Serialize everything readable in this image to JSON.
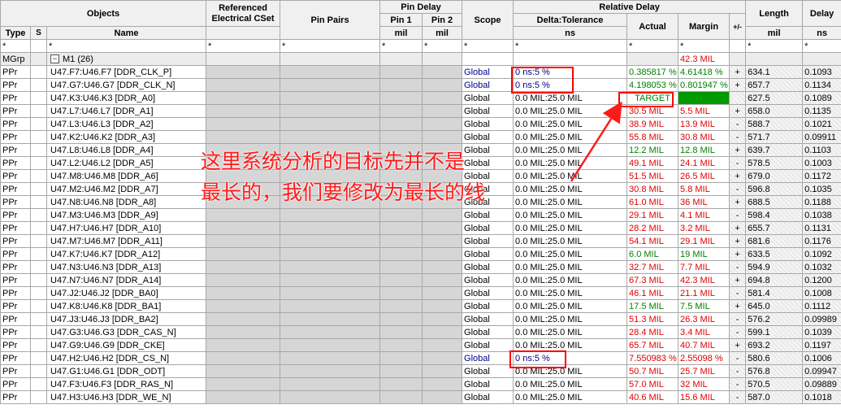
{
  "header": {
    "objects": "Objects",
    "ref_cset": "Referenced Electrical CSet",
    "pin_pairs": "Pin Pairs",
    "pin_delay": "Pin Delay",
    "pin1": "Pin 1",
    "pin2": "Pin 2",
    "scope": "Scope",
    "relative_delay": "Relative Delay",
    "delta_tol": "Delta:Tolerance",
    "actual": "Actual",
    "margin": "Margin",
    "plusminus": "+/-",
    "length": "Length",
    "delay": "Delay",
    "type": "Type",
    "s": "S",
    "name": "Name",
    "unit_mil": "mil",
    "unit_ns": "ns",
    "star": "*"
  },
  "group": {
    "type": "MGrp",
    "name": "M1 (26)",
    "margin": "42.3 MIL"
  },
  "rows": [
    {
      "type": "PPr",
      "name": "U47.F7:U46.F7 [DDR_CLK_P]",
      "scope": "Global",
      "tol": "0 ns:5 %",
      "actual": "0.385817 %",
      "margin": "4.61418 %",
      "pm": "+",
      "length": "634.1",
      "delay": "0.1093",
      "status": "green",
      "override": true
    },
    {
      "type": "PPr",
      "name": "U47.G7:U46.G7 [DDR_CLK_N]",
      "scope": "Global",
      "tol": "0 ns:5 %",
      "actual": "4.198053 %",
      "margin": "0.801947 %",
      "pm": "+",
      "length": "657.7",
      "delay": "0.1134",
      "status": "green",
      "override": true
    },
    {
      "type": "PPr",
      "name": "U47.K3:U46.K3 [DDR_A0]",
      "scope": "Global",
      "tol": "0.0 MIL:25.0 MIL",
      "actual": "TARGET",
      "margin": "",
      "pm": "",
      "length": "627.5",
      "delay": "0.1089",
      "status": "target",
      "override": false
    },
    {
      "type": "PPr",
      "name": "U47.L7:U46.L7 [DDR_A1]",
      "scope": "Global",
      "tol": "0.0 MIL:25.0 MIL",
      "actual": "30.5 MIL",
      "margin": "5.5 MIL",
      "pm": "+",
      "length": "658.0",
      "delay": "0.1135",
      "status": "red",
      "override": false
    },
    {
      "type": "PPr",
      "name": "U47.L3:U46.L3 [DDR_A2]",
      "scope": "Global",
      "tol": "0.0 MIL:25.0 MIL",
      "actual": "38.9 MIL",
      "margin": "13.9 MIL",
      "pm": "-",
      "length": "588.7",
      "delay": "0.1021",
      "status": "red",
      "override": false
    },
    {
      "type": "PPr",
      "name": "U47.K2:U46.K2 [DDR_A3]",
      "scope": "Global",
      "tol": "0.0 MIL:25.0 MIL",
      "actual": "55.8 MIL",
      "margin": "30.8 MIL",
      "pm": "-",
      "length": "571.7",
      "delay": "0.09911",
      "status": "red",
      "override": false
    },
    {
      "type": "PPr",
      "name": "U47.L8:U46.L8 [DDR_A4]",
      "scope": "Global",
      "tol": "0.0 MIL:25.0 MIL",
      "actual": "12.2 MIL",
      "margin": "12.8 MIL",
      "pm": "+",
      "length": "639.7",
      "delay": "0.1103",
      "status": "green",
      "override": false
    },
    {
      "type": "PPr",
      "name": "U47.L2:U46.L2 [DDR_A5]",
      "scope": "Global",
      "tol": "0.0 MIL:25.0 MIL",
      "actual": "49.1 MIL",
      "margin": "24.1 MIL",
      "pm": "-",
      "length": "578.5",
      "delay": "0.1003",
      "status": "red",
      "override": false
    },
    {
      "type": "PPr",
      "name": "U47.M8:U46.M8 [DDR_A6]",
      "scope": "Global",
      "tol": "0.0 MIL:25.0 MIL",
      "actual": "51.5 MIL",
      "margin": "26.5 MIL",
      "pm": "+",
      "length": "679.0",
      "delay": "0.1172",
      "status": "red",
      "override": false
    },
    {
      "type": "PPr",
      "name": "U47.M2:U46.M2 [DDR_A7]",
      "scope": "Global",
      "tol": "0.0 MIL:25.0 MIL",
      "actual": "30.8 MIL",
      "margin": "5.8 MIL",
      "pm": "-",
      "length": "596.8",
      "delay": "0.1035",
      "status": "red",
      "override": false
    },
    {
      "type": "PPr",
      "name": "U47.N8:U46.N8 [DDR_A8]",
      "scope": "Global",
      "tol": "0.0 MIL:25.0 MIL",
      "actual": "61.0 MIL",
      "margin": "36 MIL",
      "pm": "+",
      "length": "688.5",
      "delay": "0.1188",
      "status": "red",
      "override": false
    },
    {
      "type": "PPr",
      "name": "U47.M3:U46.M3 [DDR_A9]",
      "scope": "Global",
      "tol": "0.0 MIL:25.0 MIL",
      "actual": "29.1 MIL",
      "margin": "4.1 MIL",
      "pm": "-",
      "length": "598.4",
      "delay": "0.1038",
      "status": "red",
      "override": false
    },
    {
      "type": "PPr",
      "name": "U47.H7:U46.H7 [DDR_A10]",
      "scope": "Global",
      "tol": "0.0 MIL:25.0 MIL",
      "actual": "28.2 MIL",
      "margin": "3.2 MIL",
      "pm": "+",
      "length": "655.7",
      "delay": "0.1131",
      "status": "red",
      "override": false
    },
    {
      "type": "PPr",
      "name": "U47.M7:U46.M7 [DDR_A11]",
      "scope": "Global",
      "tol": "0.0 MIL:25.0 MIL",
      "actual": "54.1 MIL",
      "margin": "29.1 MIL",
      "pm": "+",
      "length": "681.6",
      "delay": "0.1176",
      "status": "red",
      "override": false
    },
    {
      "type": "PPr",
      "name": "U47.K7:U46.K7 [DDR_A12]",
      "scope": "Global",
      "tol": "0.0 MIL:25.0 MIL",
      "actual": "6.0 MIL",
      "margin": "19 MIL",
      "pm": "+",
      "length": "633.5",
      "delay": "0.1092",
      "status": "green",
      "override": false
    },
    {
      "type": "PPr",
      "name": "U47.N3:U46.N3 [DDR_A13]",
      "scope": "Global",
      "tol": "0.0 MIL:25.0 MIL",
      "actual": "32.7 MIL",
      "margin": "7.7 MIL",
      "pm": "-",
      "length": "594.9",
      "delay": "0.1032",
      "status": "red",
      "override": false
    },
    {
      "type": "PPr",
      "name": "U47.N7:U46.N7 [DDR_A14]",
      "scope": "Global",
      "tol": "0.0 MIL:25.0 MIL",
      "actual": "67.3 MIL",
      "margin": "42.3 MIL",
      "pm": "+",
      "length": "694.8",
      "delay": "0.1200",
      "status": "red",
      "override": false
    },
    {
      "type": "PPr",
      "name": "U47.J2:U46.J2 [DDR_BA0]",
      "scope": "Global",
      "tol": "0.0 MIL:25.0 MIL",
      "actual": "46.1 MIL",
      "margin": "21.1 MIL",
      "pm": "-",
      "length": "581.4",
      "delay": "0.1008",
      "status": "red",
      "override": false
    },
    {
      "type": "PPr",
      "name": "U47.K8:U46.K8 [DDR_BA1]",
      "scope": "Global",
      "tol": "0.0 MIL:25.0 MIL",
      "actual": "17.5 MIL",
      "margin": "7.5 MIL",
      "pm": "+",
      "length": "645.0",
      "delay": "0.1112",
      "status": "green",
      "override": false
    },
    {
      "type": "PPr",
      "name": "U47.J3:U46.J3 [DDR_BA2]",
      "scope": "Global",
      "tol": "0.0 MIL:25.0 MIL",
      "actual": "51.3 MIL",
      "margin": "26.3 MIL",
      "pm": "-",
      "length": "576.2",
      "delay": "0.09989",
      "status": "red",
      "override": false
    },
    {
      "type": "PPr",
      "name": "U47.G3:U46.G3 [DDR_CAS_N]",
      "scope": "Global",
      "tol": "0.0 MIL:25.0 MIL",
      "actual": "28.4 MIL",
      "margin": "3.4 MIL",
      "pm": "-",
      "length": "599.1",
      "delay": "0.1039",
      "status": "red",
      "override": false
    },
    {
      "type": "PPr",
      "name": "U47.G9:U46.G9 [DDR_CKE]",
      "scope": "Global",
      "tol": "0.0 MIL:25.0 MIL",
      "actual": "65.7 MIL",
      "margin": "40.7 MIL",
      "pm": "+",
      "length": "693.2",
      "delay": "0.1197",
      "status": "red",
      "override": false
    },
    {
      "type": "PPr",
      "name": "U47.H2:U46.H2 [DDR_CS_N]",
      "scope": "Global",
      "tol": "0 ns:5 %",
      "actual": "7.550983 %",
      "margin": "2.55098 %",
      "pm": "-",
      "length": "580.6",
      "delay": "0.1006",
      "status": "red",
      "override": true
    },
    {
      "type": "PPr",
      "name": "U47.G1:U46.G1 [DDR_ODT]",
      "scope": "Global",
      "tol": "0.0 MIL:25.0 MIL",
      "actual": "50.7 MIL",
      "margin": "25.7 MIL",
      "pm": "-",
      "length": "576.8",
      "delay": "0.09947",
      "status": "red",
      "override": false
    },
    {
      "type": "PPr",
      "name": "U47.F3:U46.F3 [DDR_RAS_N]",
      "scope": "Global",
      "tol": "0.0 MIL:25.0 MIL",
      "actual": "57.0 MIL",
      "margin": "32 MIL",
      "pm": "-",
      "length": "570.5",
      "delay": "0.09889",
      "status": "red",
      "override": false
    },
    {
      "type": "PPr",
      "name": "U47.H3:U46.H3 [DDR_WE_N]",
      "scope": "Global",
      "tol": "0.0 MIL:25.0 MIL",
      "actual": "40.6 MIL",
      "margin": "15.6 MIL",
      "pm": "-",
      "length": "587.0",
      "delay": "0.1018",
      "status": "red",
      "override": false
    }
  ],
  "annotation": {
    "line1": "这里系统分析的目标先并不是",
    "line2": "最长的，我们要修改为最长的线"
  },
  "colors": {
    "red": "#e00000",
    "green": "#008000",
    "blue": "#00008b",
    "box": "#ff0000"
  }
}
